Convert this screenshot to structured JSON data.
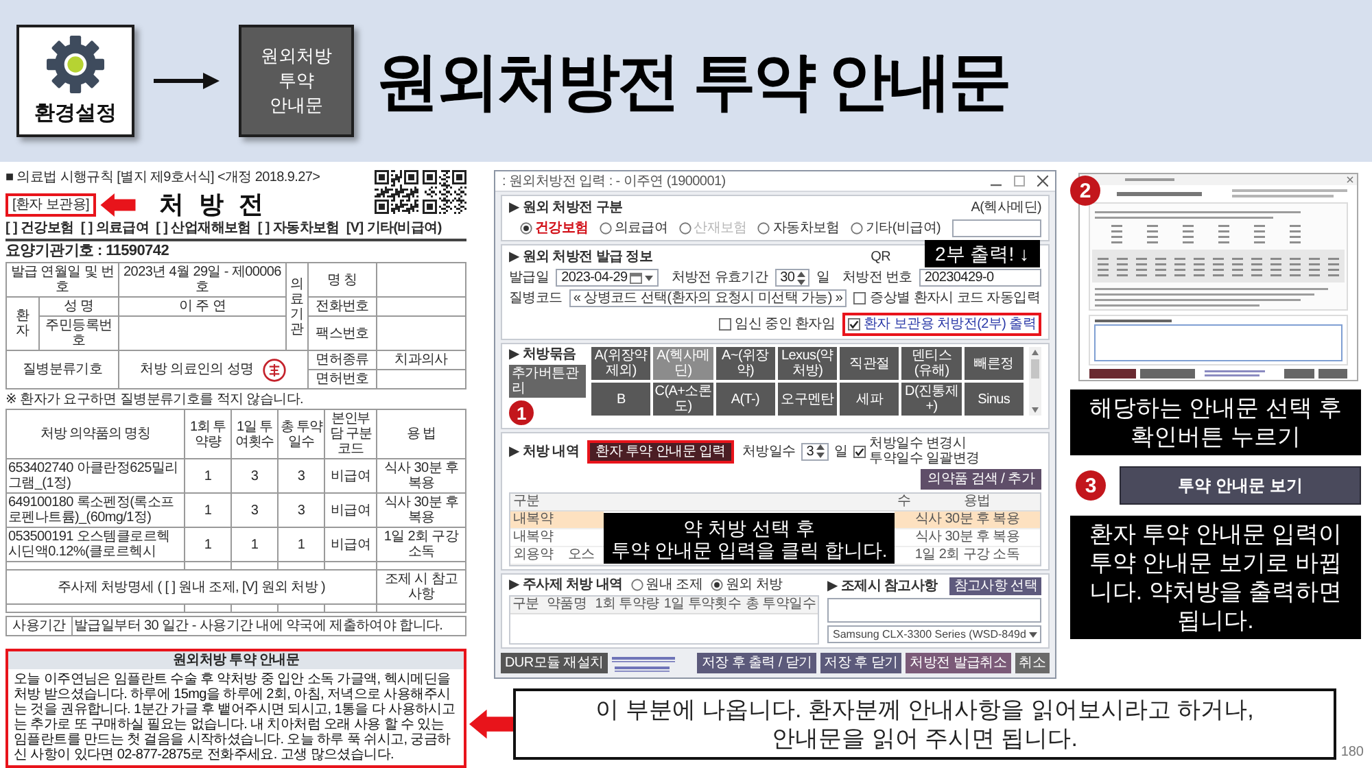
{
  "header": {
    "settings_label": "환경설정",
    "menu_tile": "원외처방\n투약\n안내문",
    "title": "원외처방전 투약 안내문"
  },
  "prescription": {
    "form_note": "■ 의료법 시행규칙 [별지 제9호서식] <개정 2018.9.27>",
    "copy_label": "[환자 보관용]",
    "title": "처 방 전",
    "insurance": [
      "[ ] 건강보험",
      "[ ] 의료급여",
      "[ ] 산업재해보험",
      "[ ] 자동차보험",
      "[V] 기타(비급여)"
    ],
    "institution_code": "요양기관기호 : 11590742",
    "info": {
      "issue_label": "발급 연월일 및 번호",
      "issue_value": "2023년 4월 29일 - 제00006호",
      "institution_label": "의료기관",
      "name_label": "명 칭",
      "patient_label": "환자",
      "patient_name_label": "성 명",
      "patient_name": "이 주 연",
      "phone_label": "전화번호",
      "rrn_label": "주민등록번호",
      "fax_label": "팩스번호",
      "disease_label": "질병분류기호",
      "doctor_label": "처방 의료인의 성명",
      "license_type_label": "면허종류",
      "license_type": "치과의사",
      "license_no_label": "면허번호"
    },
    "notice": "※ 환자가 요구하면 질병분류기호를 적지 않습니다.",
    "med_columns": [
      "처방 의약품의 명칭",
      "1회 투약량",
      "1일 투여횟수",
      "총 투약일수",
      "본인부담 구분코드",
      "용 법"
    ],
    "med_rows": [
      [
        "653402740 아클란정625밀리그램_(1정)",
        "1",
        "3",
        "3",
        "비급여",
        "식사 30분 후 복용"
      ],
      [
        "649100180 록소펜정(록소프로펜나트륨)_(60mg/1정)",
        "1",
        "3",
        "3",
        "비급여",
        "식사 30분 후 복용"
      ],
      [
        "053500191 오스템클로르헥시딘액0.12%(클로르헥시",
        "1",
        "1",
        "1",
        "비급여",
        "1일 2회 구강 소독"
      ]
    ],
    "injection_header": "주사제 처방명세 ( [ ] 원내 조제, [V] 원외 처방 )",
    "dispense_header": "조제 시 참고 사항",
    "validity_label": "사용기간",
    "validity_text": "발급일부터 30 일간 - 사용기간 내에 약국에 제출하여야 합니다.",
    "guide_title": "원외처방 투약 안내문",
    "guide_text": "오늘 이주연님은 임플란트 수술 후 약처방 중 입안 소독 가글액, 헥시메딘을 처방 받으셨습니다. 하루에 15mg을 하루에 2회, 아침, 저녁으로 사용해주시는 것을 권유합니다. 1분간 가글 후 뱉어주시면 되시고, 1통을 다 사용하시고는 추가로 또 구매하실 필요는 없습니다. 내 치아처럼 오래 사용 할 수 있는 임플란트를 만드는 첫 걸음을 시작하셨습니다. 오늘 하루 푹 쉬시고, 궁금하신 사항이 있다면 02-877-2875로 전화주세요. 고생 많으셨습니다."
  },
  "app_window": {
    "title": ": 원외처방전 입력 : - 이주연 (1900001)",
    "type_section": {
      "title": "▶ 원외 처방전 구분",
      "preset": "A(헥사메딘)",
      "options": [
        {
          "label": "건강보험",
          "selected": true,
          "disabled": false
        },
        {
          "label": "의료급여",
          "selected": false,
          "disabled": false
        },
        {
          "label": "산재보험",
          "selected": false,
          "disabled": true
        },
        {
          "label": "자동차보험",
          "selected": false,
          "disabled": false
        },
        {
          "label": "기타(비급여)",
          "selected": false,
          "disabled": false
        }
      ]
    },
    "issue_section": {
      "title": "▶ 원외 처방전 발급 정보",
      "qr_label": "QR",
      "callout": "2부 출력! ↓",
      "date_label": "발급일",
      "date": "2023-04-29",
      "validity_label": "처방전 유효기간",
      "validity_days": "30",
      "day_unit": "일",
      "number_label": "처방전 번호",
      "number": "20230429-0",
      "disease_label": "질병코드",
      "disease_button": "« 상병코드 선택(환자의 요청시 미선택 가능) »",
      "checks": [
        {
          "label": "증상별 환자시 코드 자동입력",
          "checked": false,
          "highlighted": false
        },
        {
          "label": "임신 중인 환자임",
          "checked": false,
          "highlighted": false
        },
        {
          "label": "환자 보관용 처방전(2부) 출력",
          "checked": true,
          "highlighted": true
        }
      ]
    },
    "preset_section": {
      "title": "▶ 처방묶음",
      "manage_button": "추가버튼관리",
      "step": "1",
      "buttons": [
        {
          "label": "A(위장약제외)",
          "selected": false
        },
        {
          "label": "A(헥사메딘)",
          "selected": true
        },
        {
          "label": "A~(위장약)",
          "selected": false
        },
        {
          "label": "Lexus(약처방)",
          "selected": false
        },
        {
          "label": "직관절",
          "selected": false
        },
        {
          "label": "덴티스(유해)",
          "selected": false
        },
        {
          "label": "빼른정",
          "selected": false
        },
        {
          "label": "B",
          "selected": false
        },
        {
          "label": "C(A+소론도)",
          "selected": false
        },
        {
          "label": "A(T-)",
          "selected": false
        },
        {
          "label": "오구멘탄",
          "selected": false
        },
        {
          "label": "세파",
          "selected": false
        },
        {
          "label": "D(진통제+)",
          "selected": false
        },
        {
          "label": "Sinus",
          "selected": false
        }
      ]
    },
    "rx_section": {
      "title": "▶ 처방 내역",
      "guide_button": "환자 투약 안내문 입력",
      "days_label": "처방일수",
      "days": "3",
      "days_unit": "일",
      "sync_check": {
        "label": "처방일수 변경시\n투약일수 일괄변경",
        "checked": true
      },
      "search_button": "의약품 검색 / 추가",
      "columns": [
        "구분",
        "수",
        "용법"
      ],
      "rows": [
        {
          "type": "내복약",
          "usage": "식사 30분 후 복용",
          "selected": true
        },
        {
          "type": "내복약",
          "usage": "식사 30분 후 복용",
          "selected": false
        },
        {
          "type": "외용약",
          "name": "오스",
          "usage": "1일 2회 구강 소독",
          "selected": false
        }
      ],
      "caption": "약 처방 선택 후\n투약 안내문 입력을 클릭 합니다."
    },
    "injection_section": {
      "title": "▶ 주사제 처방 내역",
      "options": [
        {
          "label": "원내 조제",
          "selected": false
        },
        {
          "label": "원외 처방",
          "selected": true
        }
      ],
      "columns": [
        "구분",
        "약품명",
        "1회 투약량",
        "1일 투약횟수",
        "총 투약일수"
      ]
    },
    "note_section": {
      "title": "▶ 조제시 참고사항",
      "button": "참고사항 선택",
      "printer": "Samsung CLX-3300 Series (WSD-849d"
    },
    "footer": {
      "dur_button": "DUR모듈 재설치",
      "buttons": [
        {
          "label": "저장 후 출력 / 닫기",
          "kind": "save"
        },
        {
          "label": "저장 후 닫기",
          "kind": "save"
        },
        {
          "label": "처방전 발급취소",
          "kind": "revoke"
        },
        {
          "label": "취소",
          "kind": "cancel"
        }
      ]
    }
  },
  "side_panel": {
    "step2": "2",
    "caption1": "해당하는 안내문 선택 후\n확인버튼 누르기",
    "step3": "3",
    "view_button": "투약 안내문 보기",
    "caption2": "환자 투약 안내문 입력이\n투약 안내문 보기로 바뀝\n니다. 약처방을 출력하면\n됩니다."
  },
  "bottom_note": {
    "text": "이 부분에 나옵니다. 환자분께 안내사항을 읽어보시라고 하거나,\n안내문을 읽어 주시면 됩니다.",
    "page_number": "180"
  }
}
